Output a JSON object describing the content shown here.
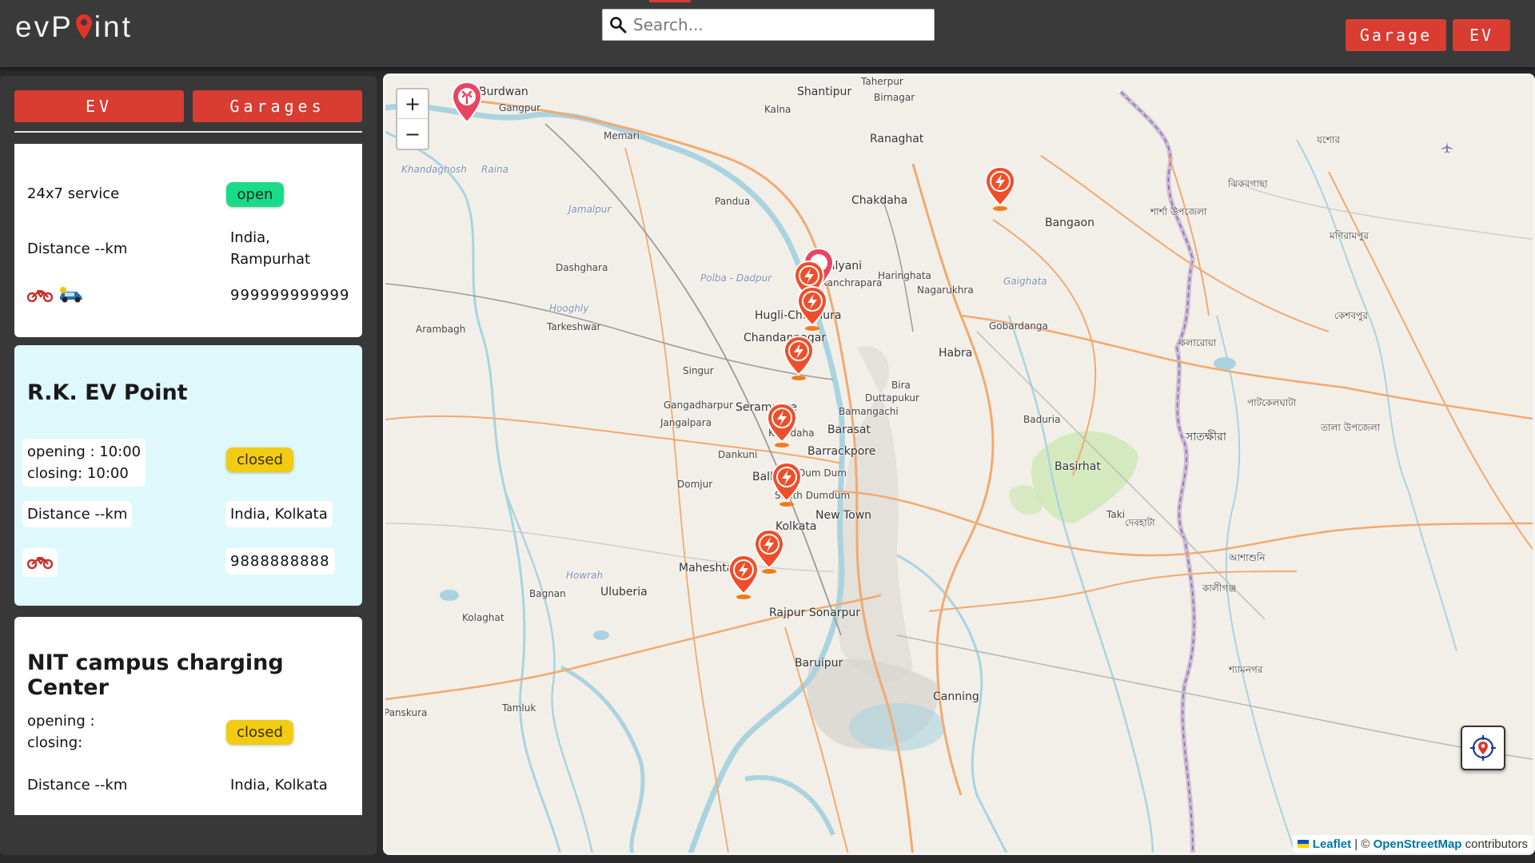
{
  "header": {
    "logo_text": "evPoint",
    "search_placeholder": "Search...",
    "garage_button": "Garage",
    "ev_button": "EV"
  },
  "sidebar": {
    "tabs": [
      "EV",
      "Garages"
    ],
    "cards": [
      {
        "title": "",
        "hours_text": "24x7 service",
        "status": "open",
        "distance": "Distance --km",
        "location": "India, Rampurhat",
        "vehicle_icons": [
          "motorbike-icon",
          "car-icon"
        ],
        "phone": "999999999999"
      },
      {
        "title": "R.K. EV Point",
        "hours_text": "opening : 10:00\nclosing: 10:00",
        "status": "closed",
        "distance": "Distance --km",
        "location": "India, Kolkata",
        "vehicle_icons": [
          "motorbike-icon"
        ],
        "phone": "9888888888",
        "highlighted": true
      },
      {
        "title": "NIT campus charging Center",
        "hours_text": "opening :\nclosing:",
        "status": "closed",
        "distance": "Distance --km",
        "location": "India, Kolkata"
      }
    ]
  },
  "map": {
    "zoom_in": "+",
    "zoom_out": "−",
    "attribution": {
      "leaflet": "Leaflet",
      "separator": " | © ",
      "osm": "OpenStreetMap",
      "suffix": " contributors"
    },
    "places": [
      "Shantipur",
      "Taherpur",
      "Birnagar",
      "Kalna",
      "Memari",
      "Gangpur",
      "Ranaghat",
      "Chakdaha",
      "Bangaon",
      "Pandua",
      "Haringhata",
      "Nagarukhra",
      "Dashghara",
      "Hooghly",
      "Tarkeshwar",
      "Arambagh",
      "Hugli-Chuchura",
      "Chandannagar",
      "Gobardanga",
      "Habra",
      "Singur",
      "Bira",
      "Duttapukur",
      "Gangadharpur",
      "Serampore",
      "Bamangachi",
      "Baduria",
      "Jangalpara",
      "Khardaha",
      "Barasat",
      "Barrackpore",
      "Dankuni",
      "Bally",
      "Dum Dum",
      "Domjur",
      "South Dumdum",
      "New Town",
      "Kolkata",
      "Basirhat",
      "Taki",
      "Maheshtala",
      "Howrah",
      "Uluberia",
      "Bagnan",
      "Kolaghat",
      "Rajpur Sonarpur",
      "Canning",
      "Baruipur",
      "Tamluk",
      "Khandaghosh",
      "Raina",
      "Jamalpur",
      "Polba - Dadpur",
      "Gaighata",
      "Burdwan",
      "Kalyani",
      "Kanchrapara",
      "Panskura"
    ],
    "bengali_places": [
      "যশোর",
      "ঝিকরগাছা",
      "শার্শা উপজেলা",
      "মণিরামপুর",
      "কেশবপুর",
      "কলারোয়া",
      "সাতক্ষীরা",
      "পাটকেলঘাটা",
      "তালা উপজেলা",
      "দেবহাটা",
      "আশাশুনি",
      "কালীগঞ্জ",
      "শ্যামনগর"
    ],
    "marker_types": [
      "garage-marker",
      "charging-marker"
    ]
  }
}
